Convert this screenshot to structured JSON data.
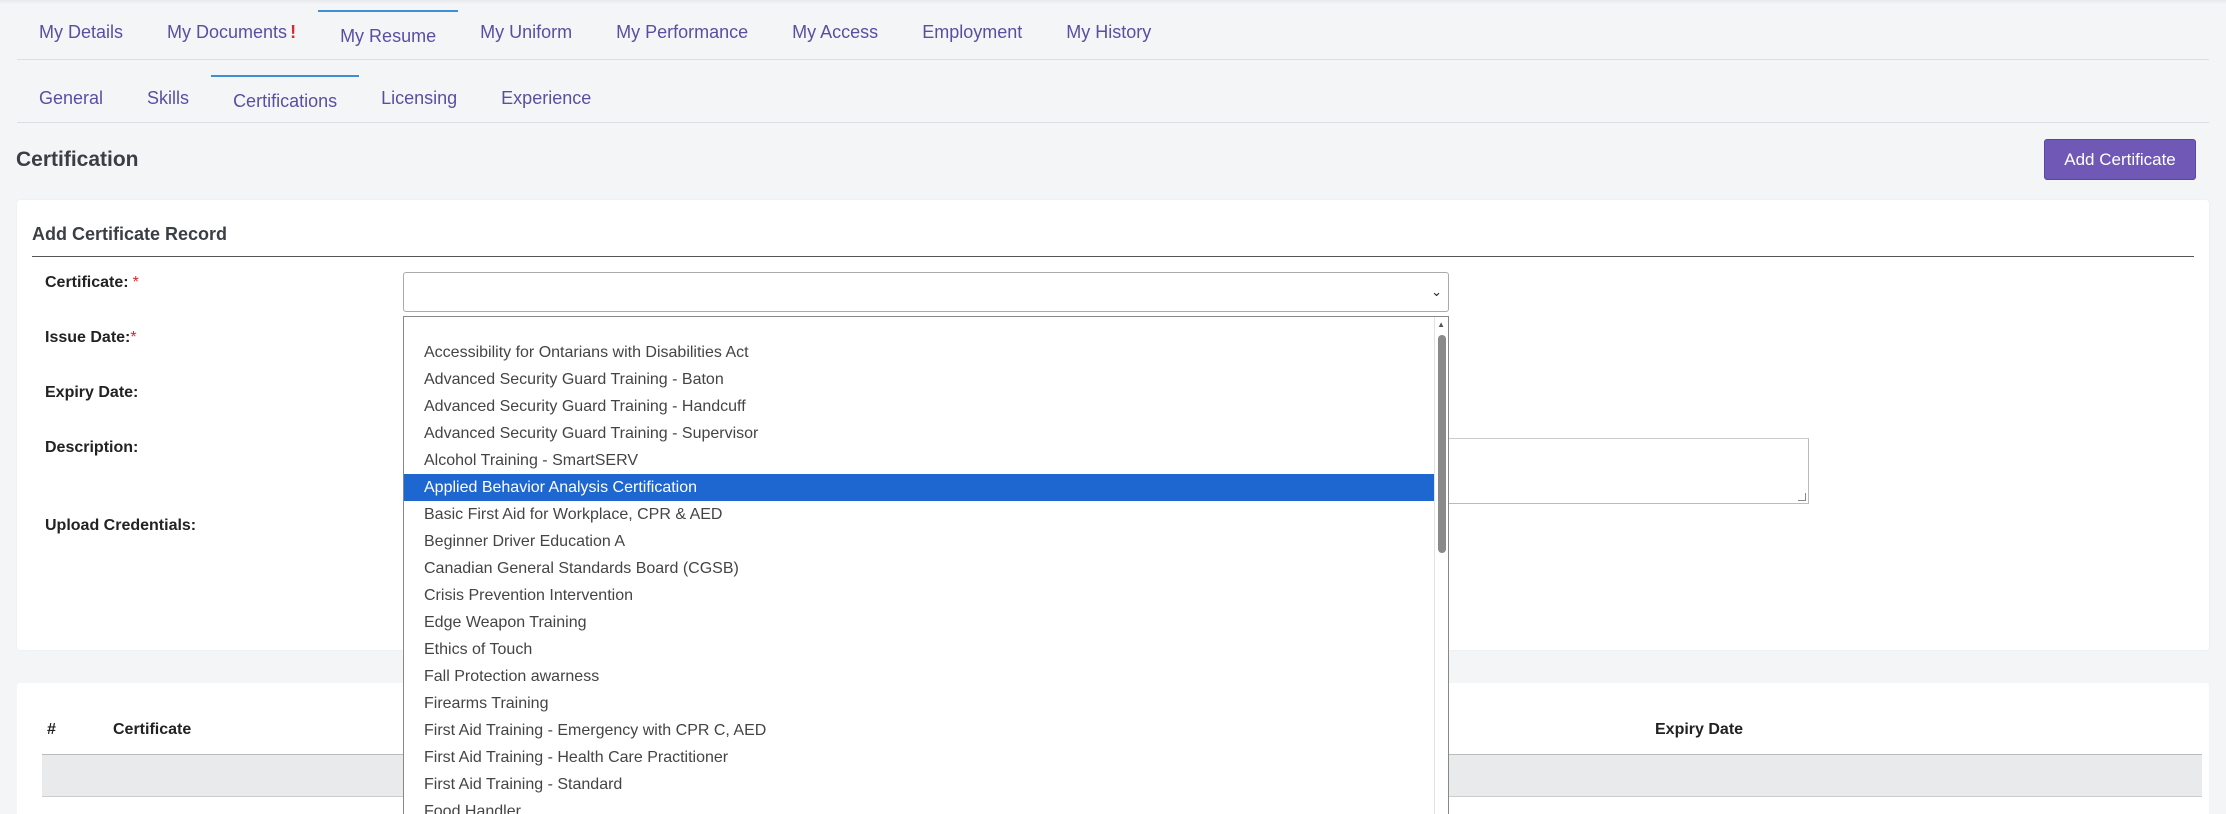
{
  "nav_tabs": [
    {
      "label": "My Details",
      "alert": ""
    },
    {
      "label": "My Documents",
      "alert": "!"
    },
    {
      "label": "My Resume",
      "alert": ""
    },
    {
      "label": "My Uniform",
      "alert": ""
    },
    {
      "label": "My Performance",
      "alert": ""
    },
    {
      "label": "My Access",
      "alert": ""
    },
    {
      "label": "Employment",
      "alert": ""
    },
    {
      "label": "My History",
      "alert": ""
    }
  ],
  "sub_tabs": [
    "General",
    "Skills",
    "Certifications",
    "Licensing",
    "Experience"
  ],
  "page": {
    "title": "Certification",
    "add_button": "Add Certificate"
  },
  "form": {
    "title": "Add Certificate Record",
    "certificate_label": "Certificate:",
    "issue_date_label": "Issue Date:",
    "expiry_date_label": "Expiry Date:",
    "description_label": "Description:",
    "upload_label": "Upload Credentials:",
    "required_mark": "*",
    "certificate_value": ""
  },
  "table": {
    "headers": [
      "#",
      "Certificate",
      "Expiry Date"
    ]
  },
  "dropdown": {
    "selected_index": 6,
    "options": [
      "",
      "Accessibility for Ontarians with Disabilities Act",
      "Advanced Security Guard Training - Baton",
      "Advanced Security Guard Training - Handcuff",
      "Advanced Security Guard Training - Supervisor",
      "Alcohol Training - SmartSERV",
      "Applied Behavior Analysis Certification",
      "Basic First Aid for Workplace, CPR & AED",
      "Beginner Driver Education A",
      "Canadian General Standards Board (CGSB)",
      "Crisis Prevention Intervention",
      "Edge Weapon Training",
      "Ethics of Touch",
      "Fall Protection awarness",
      "Firearms Training",
      "First Aid Training - Emergency with CPR C, AED",
      "First Aid Training - Health Care Practitioner",
      "First Aid Training - Standard",
      "Food Handler"
    ]
  },
  "colors": {
    "tab_text": "#5a4ea3",
    "active_tab_border": "#3d8fd6",
    "primary_button": "#6f58b6",
    "selected_option": "#1e66d0",
    "required": "#d9262f"
  }
}
